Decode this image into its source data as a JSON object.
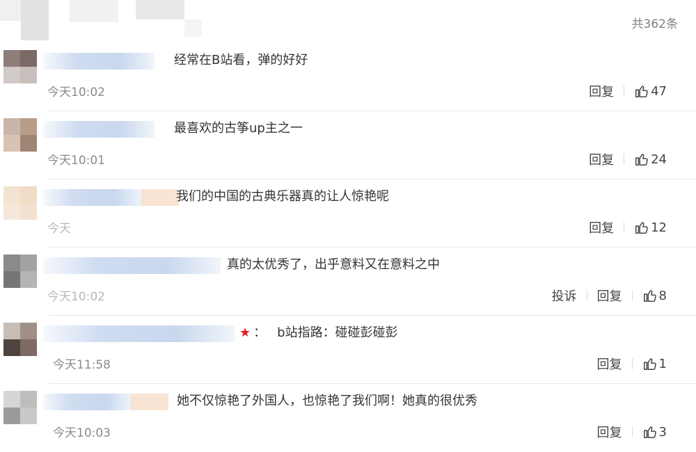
{
  "header": {
    "total": "共362条"
  },
  "comments": [
    {
      "text": "经常在B站看，弹的好好",
      "time": "今天10:02",
      "reply_label": "回复",
      "likes": "47"
    },
    {
      "text": "最喜欢的古筝up主之一",
      "time": "今天10:01",
      "reply_label": "回复",
      "likes": "24"
    },
    {
      "text": "我们的中国的古典乐器真的让人惊艳呢",
      "time": "今天",
      "reply_label": "回复",
      "likes": "12"
    },
    {
      "text": "真的太优秀了，出乎意料又在意料之中",
      "time": "今天10:02",
      "report_label": "投诉",
      "reply_label": "回复",
      "likes": "8"
    },
    {
      "text_prefix": "：",
      "text": "b站指路：碰碰彭碰彭",
      "time": "今天11:58",
      "reply_label": "回复",
      "likes": "1"
    },
    {
      "text": "她不仅惊艳了外国人，也惊艳了我们啊！她真的很优秀",
      "time": "今天10:03",
      "reply_label": "回复",
      "likes": "3"
    }
  ]
}
